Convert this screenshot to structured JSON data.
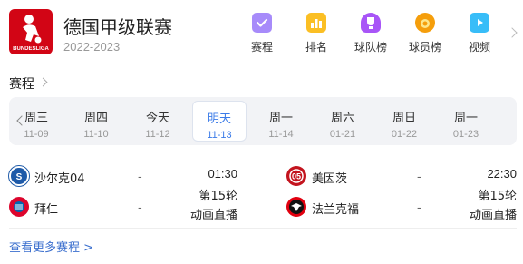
{
  "header": {
    "logo_text": "BUNDESLIGA",
    "title": "德国甲级联赛",
    "season": "2022-2023"
  },
  "nav": [
    {
      "label": "赛程",
      "icon": "calendar-check-icon",
      "color": "#a78bfa"
    },
    {
      "label": "排名",
      "icon": "bar-chart-icon",
      "color": "#fbbf24"
    },
    {
      "label": "球队榜",
      "icon": "trophy-icon",
      "color": "#a855f7"
    },
    {
      "label": "球员榜",
      "icon": "medal-icon",
      "color": "#f59e0b"
    },
    {
      "label": "视频",
      "icon": "video-icon",
      "color": "#38bdf8"
    }
  ],
  "schedule": {
    "section_title": "赛程",
    "dates": [
      {
        "day": "周三",
        "date": "11-09"
      },
      {
        "day": "周四",
        "date": "11-10"
      },
      {
        "day": "今天",
        "date": "11-12"
      },
      {
        "day": "明天",
        "date": "11-13",
        "active": true
      },
      {
        "day": "周一",
        "date": "11-14"
      },
      {
        "day": "周六",
        "date": "01-21"
      },
      {
        "day": "周日",
        "date": "01-22"
      },
      {
        "day": "周一",
        "date": "01-23"
      }
    ]
  },
  "matches": [
    {
      "home": {
        "name": "沙尔克04",
        "score": "-"
      },
      "away": {
        "name": "拜仁",
        "score": "-"
      },
      "time": "01:30",
      "round": "第15轮",
      "broadcast": "动画直播"
    },
    {
      "home": {
        "name": "美因茨",
        "score": "-"
      },
      "away": {
        "name": "法兰克福",
        "score": "-"
      },
      "time": "22:30",
      "round": "第15轮",
      "broadcast": "动画直播"
    }
  ],
  "footer": {
    "more_label": "查看更多赛程 >"
  },
  "colors": {
    "accent": "#3b7be8",
    "link": "#3b6fce",
    "logo_red": "#d20515"
  }
}
